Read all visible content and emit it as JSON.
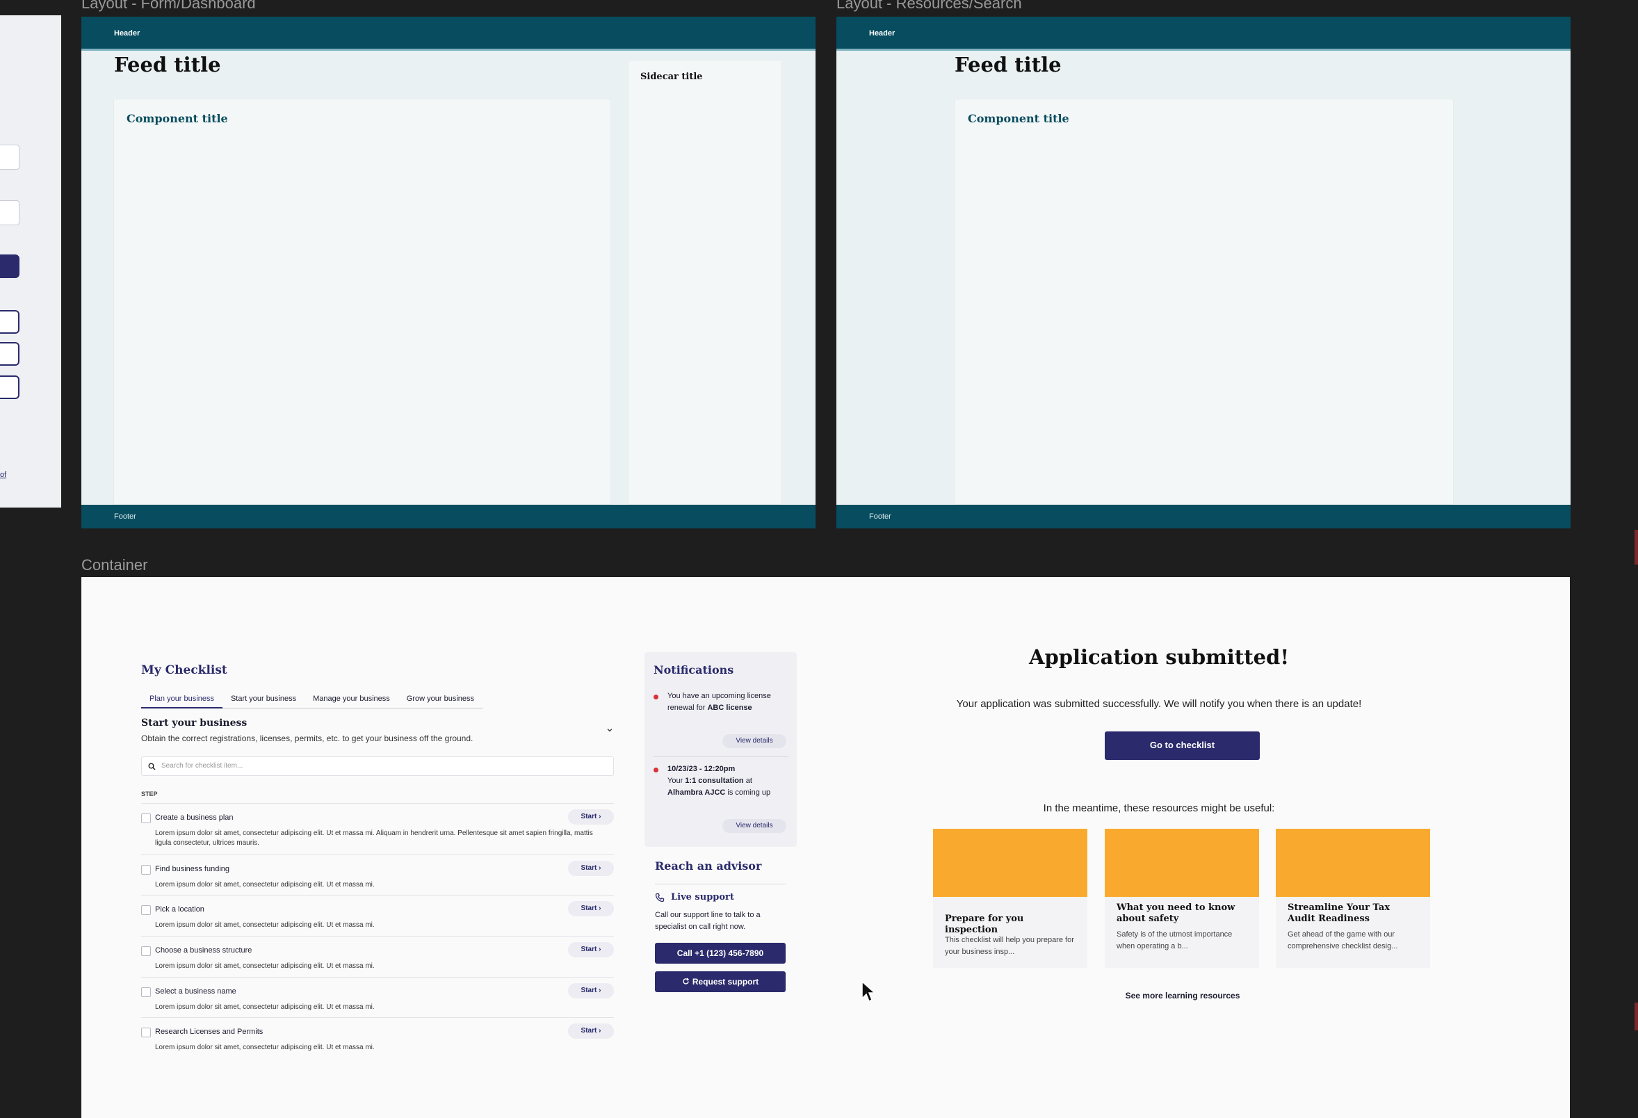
{
  "frames": {
    "form_dashboard": {
      "label": "Layout - Form/Dashboard",
      "header": "Header",
      "feed_title": "Feed title",
      "component_title": "Component title",
      "sidecar_title": "Sidecar title",
      "footer": "Footer"
    },
    "resources_search": {
      "label": "Layout - Resources/Search",
      "header": "Header",
      "feed_title": "Feed title",
      "component_title": "Component title",
      "footer": "Footer"
    },
    "left_partial": {
      "link_text": "of"
    }
  },
  "container": {
    "label": "Container",
    "checklist": {
      "title": "My Checklist",
      "tabs": [
        "Plan your business",
        "Start your business",
        "Manage your business",
        "Grow your business"
      ],
      "section_title": "Start your business",
      "section_desc": "Obtain the correct registrations, licenses, permits, etc. to get your business off the ground.",
      "search_placeholder": "Search for checklist item...",
      "step_header": "STEP",
      "start_label": "Start",
      "steps": [
        {
          "name": "Create a business plan",
          "desc": "Lorem ipsum dolor sit amet, consectetur adipiscing elit. Ut et massa mi. Aliquam in hendrerit urna. Pellentesque sit amet sapien fringilla, mattis ligula consectetur, ultrices mauris."
        },
        {
          "name": "Find business funding",
          "desc": "Lorem ipsum dolor sit amet, consectetur adipiscing elit. Ut et massa mi."
        },
        {
          "name": "Pick a location",
          "desc": "Lorem ipsum dolor sit amet, consectetur adipiscing elit. Ut et massa mi."
        },
        {
          "name": "Choose a business structure",
          "desc": "Lorem ipsum dolor sit amet, consectetur adipiscing elit. Ut et massa mi."
        },
        {
          "name": "Select a business name",
          "desc": "Lorem ipsum dolor sit amet, consectetur adipiscing elit. Ut et massa mi."
        },
        {
          "name": "Research Licenses and Permits",
          "desc": "Lorem ipsum dolor sit amet, consectetur adipiscing elit. Ut et massa mi."
        }
      ]
    },
    "notifications": {
      "title": "Notifications",
      "items": [
        {
          "pre": "You have an upcoming license renewal for ",
          "bold": "ABC license",
          "post": ""
        },
        {
          "date": "10/23/23 - 12:20pm",
          "pre": "Your ",
          "bold": "1:1 consultation",
          "mid": " at ",
          "bold2": "Alhambra AJCC",
          "post": " is coming up"
        }
      ],
      "view_details": "View details"
    },
    "advisor": {
      "title": "Reach an advisor",
      "live_title": "Live support",
      "live_desc": "Call our support line to talk to a specialist on call right now.",
      "call_button": "Call +1 (123) 456-7890",
      "request_button": "Request support"
    },
    "application": {
      "title": "Application submitted!",
      "desc": "Your application was submitted successfully. We will notify you when there is an update!",
      "button": "Go to checklist",
      "resources_intro": "In the meantime, these resources might be useful:",
      "resources": [
        {
          "title": "Prepare for you inspection",
          "desc": "This checklist will help you prepare for your business insp..."
        },
        {
          "title": "What you need to know about safety",
          "desc": "Safety is of the utmost importance when operating a b..."
        },
        {
          "title": "Streamline Your Tax Audit Readiness",
          "desc": "Get ahead of the game with our comprehensive checklist desig..."
        }
      ],
      "see_more": "See more learning resources"
    }
  },
  "colors": {
    "canvas": "#1e1e1e",
    "teal_header": "#074d5f",
    "navy_accent": "#2a2a6c",
    "resource_image": "#f9aa2e",
    "notification_dot": "#d8313b"
  },
  "icons": [
    "search-icon",
    "chevron-down-icon",
    "chevron-right-icon",
    "phone-icon",
    "refresh-icon",
    "mouse-cursor-icon"
  ]
}
